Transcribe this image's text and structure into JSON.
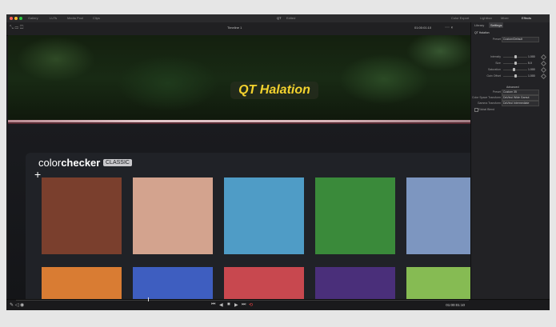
{
  "window": {
    "menu": [
      "Gallery",
      "LUTs",
      "Media Pool",
      "Clips"
    ],
    "title": "QT",
    "title_sub": "Edited",
    "top_right": [
      "Color Export",
      "Lightbox",
      "Mixer",
      "Effects"
    ]
  },
  "toolbar": {
    "timeline_name": "Timeline 1",
    "timecode_top": "01:00:01:10"
  },
  "viewer": {
    "overlay_title": "QT Halation",
    "logo_light": "color",
    "logo_bold": "checker",
    "logo_badge": "CLASSIC",
    "swatches_row1": [
      "#7a3f2d",
      "#d3a38e",
      "#4f9cc6",
      "#3a8a3a",
      "#7d96c0"
    ],
    "swatches_row2": [
      "#d97c33",
      "#3e5ec0",
      "#c8484f",
      "#4a2f7a",
      "#86bb53"
    ]
  },
  "panel": {
    "tabs": [
      "Library",
      "Settings"
    ],
    "fx_name": "QT Halation",
    "preset_label": "Preset",
    "preset_value": "Custom/Default",
    "rows": [
      {
        "label": "Intensity",
        "value": "1.000",
        "fraction": 0.5
      },
      {
        "label": "Size",
        "value": "5.0",
        "fraction": 0.5
      },
      {
        "label": "Saturation",
        "value": "1.000",
        "fraction": 0.45
      },
      {
        "label": "Gain Offset",
        "value": "1.000",
        "fraction": 0.5
      }
    ],
    "section": "Advanced",
    "drop_rows": [
      {
        "label": "Preset",
        "value": "Custom 35"
      },
      {
        "label": "Color Space Transform",
        "value": "DaVinci Wide Gamut"
      },
      {
        "label": "Gamma Transform",
        "value": "DaVinci Intermediate"
      }
    ],
    "global_blend": "Global Blend"
  },
  "bottom": {
    "timecode": "01:00:01:10"
  }
}
